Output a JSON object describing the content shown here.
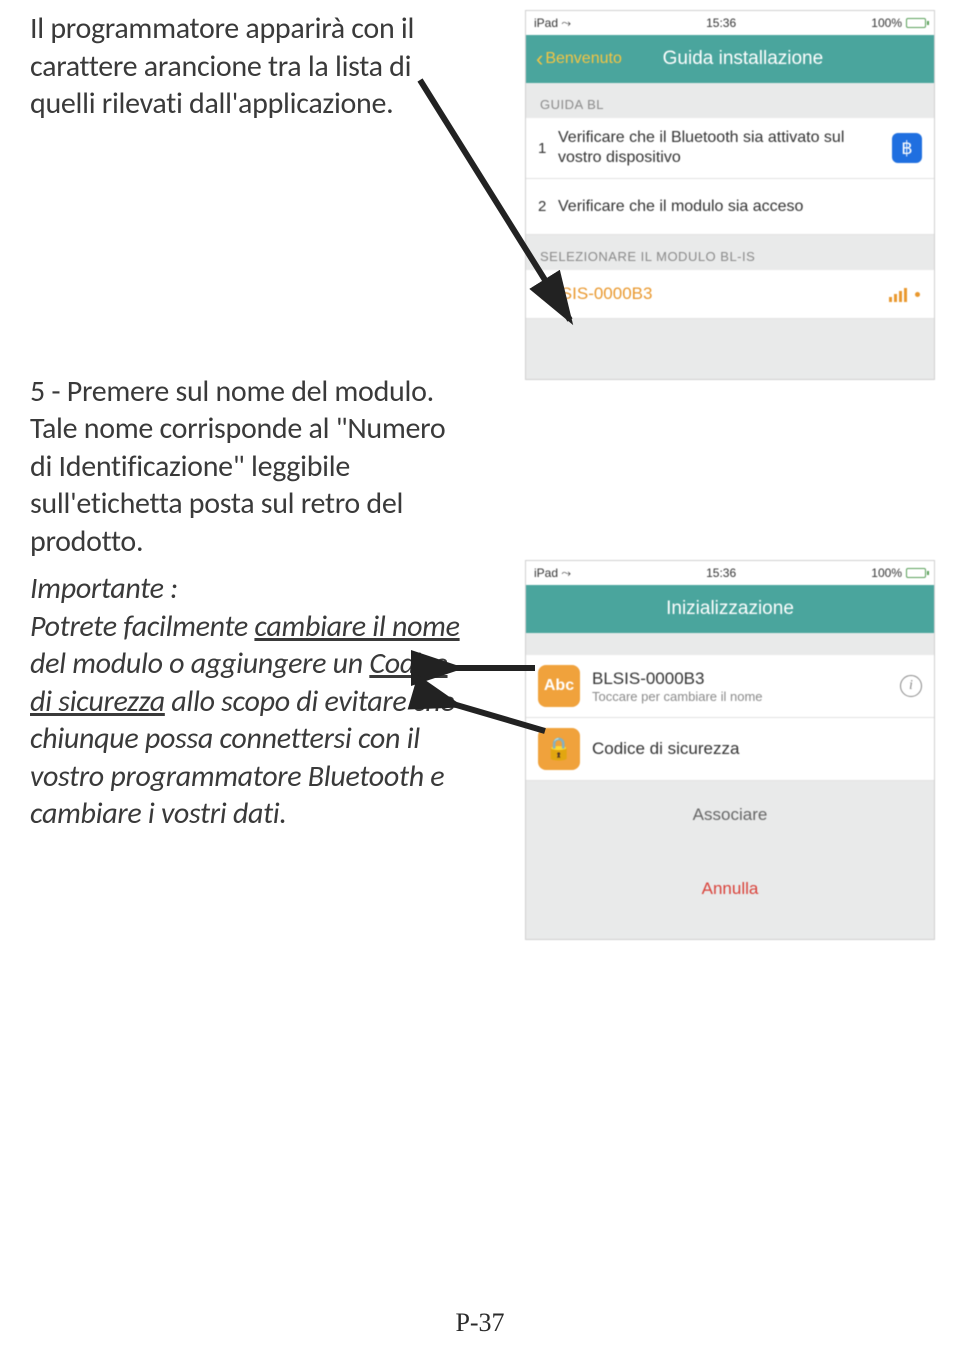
{
  "doc": {
    "para1": "Il programmatore apparirà con il carattere arancione tra la lista di quelli rilevati dall'applicazione.",
    "para2": "5 - Premere sul nome del modulo. Tale nome corrisponde al \"Numero di Identificazione\" leggibile sull'etichetta posta sul retro del prodotto.",
    "importante_label": "Importante :",
    "imp_pre": "Potrete facilmente ",
    "imp_u1": "cambiare il nome",
    "imp_mid": " del modulo o aggiungere un ",
    "imp_u2": "Codice di sicurezza",
    "imp_post": " allo scopo di evitare che chiunque possa connettersi con il vostro programmatore Bluetooth e cambiare i vostri dati.",
    "page_number": "P-37"
  },
  "phone1": {
    "status_carrier": "iPad",
    "status_time": "15:36",
    "status_batt": "100%",
    "back_label": "Benvenuto",
    "title": "Guida installazione",
    "section1": "GUIDA BL",
    "step1_num": "1",
    "step1_text": "Verificare che il Bluetooth sia attivato sul vostro dispositivo",
    "step2_num": "2",
    "step2_text": "Verificare che il modulo sia acceso",
    "section2": "SELEZIONARE IL MODULO BL-IS",
    "module_name": "BLSIS-0000B3"
  },
  "phone2": {
    "status_carrier": "iPad",
    "status_time": "15:36",
    "status_batt": "100%",
    "title": "Inizializzazione",
    "abc_box": "Abc",
    "module_name": "BLSIS-0000B3",
    "module_sub": "Toccare per cambiare il nome",
    "security_label": "Codice di sicurezza",
    "associate": "Associare",
    "cancel": "Annulla"
  }
}
